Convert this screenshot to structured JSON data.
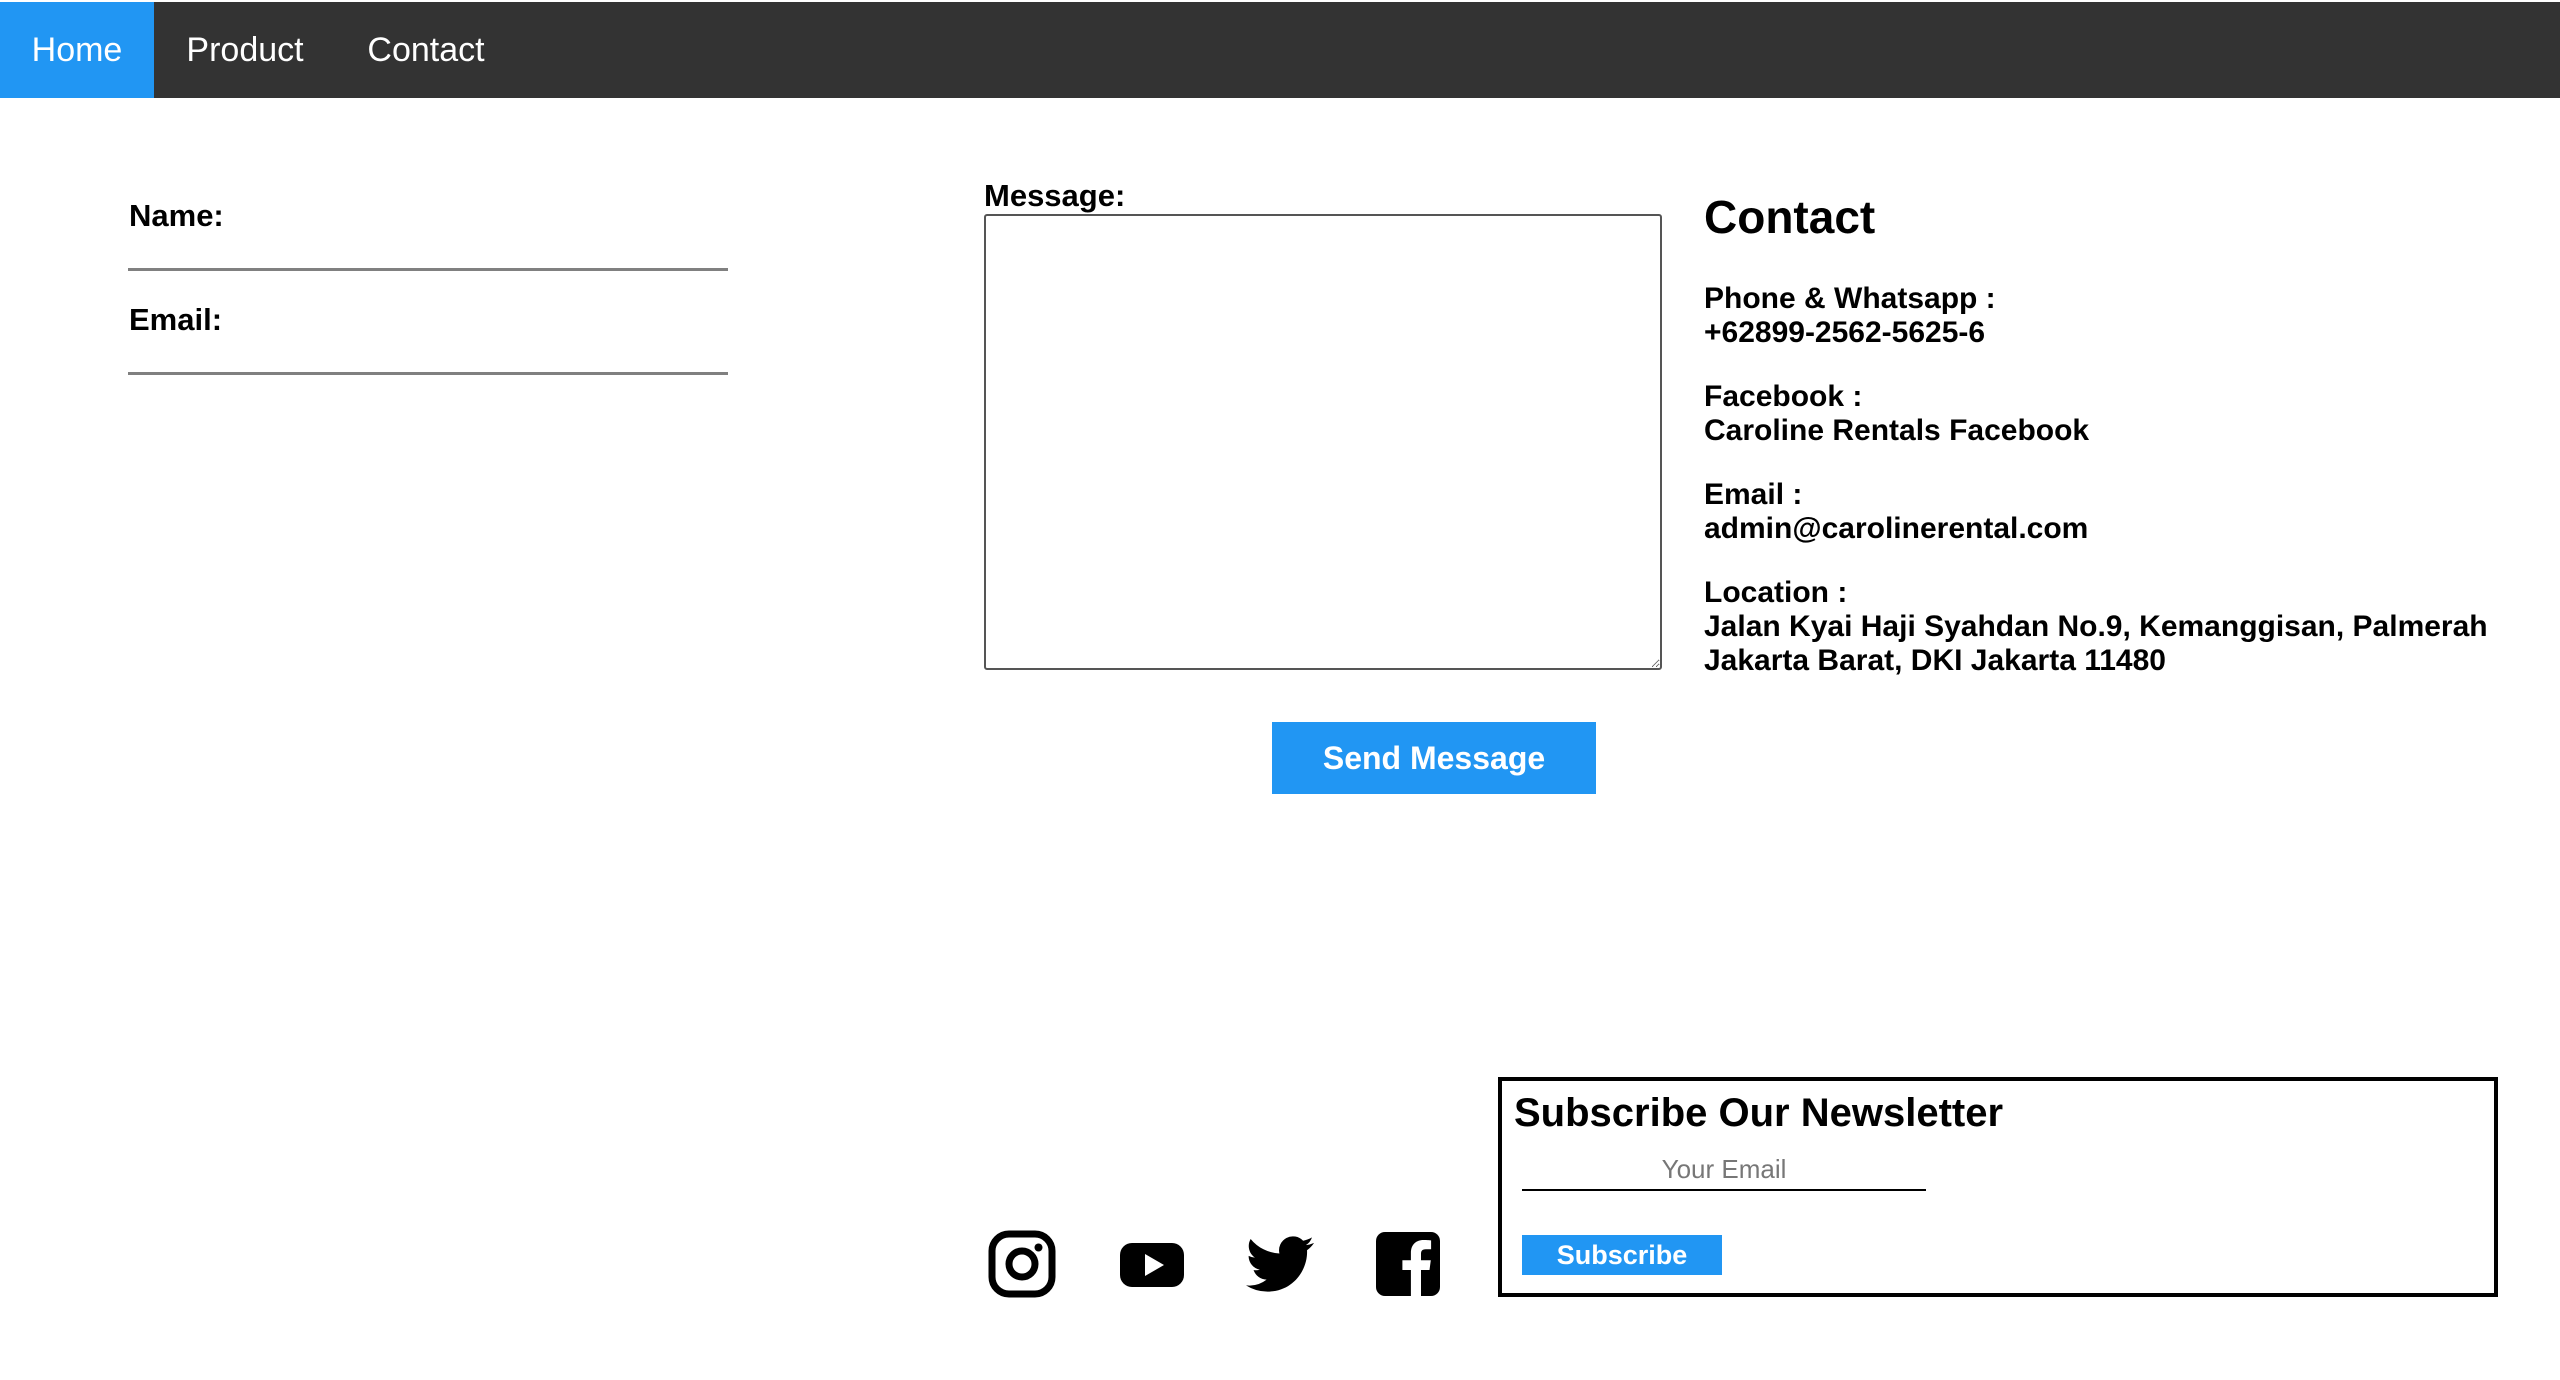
{
  "nav": {
    "items": [
      {
        "label": "Home",
        "active": true
      },
      {
        "label": "Product",
        "active": false
      },
      {
        "label": "Contact",
        "active": false
      }
    ]
  },
  "form": {
    "name_label": "Name:",
    "name_value": "",
    "email_label": "Email:",
    "email_value": "",
    "message_label": "Message:",
    "message_value": "",
    "send_label": "Send Message"
  },
  "contact": {
    "title": "Contact",
    "phone_label": "Phone & Whatsapp :",
    "phone_value": "+62899-2562-5625-6",
    "facebook_label": "Facebook :",
    "facebook_value": "Caroline Rentals Facebook",
    "email_label": "Email :",
    "email_value": "admin@carolinerental.com",
    "location_label": "Location :",
    "location_line1": "Jalan Kyai Haji Syahdan No.9, Kemanggisan, Palmerah",
    "location_line2": "Jakarta Barat, DKI Jakarta 11480"
  },
  "social": [
    "instagram-icon",
    "youtube-icon",
    "twitter-icon",
    "facebook-icon"
  ],
  "newsletter": {
    "title": "Subscribe Our Newsletter",
    "email_placeholder": "Your Email",
    "subscribe_label": "Subscribe"
  },
  "colors": {
    "nav_bg": "#333333",
    "accent": "#2196f3"
  }
}
